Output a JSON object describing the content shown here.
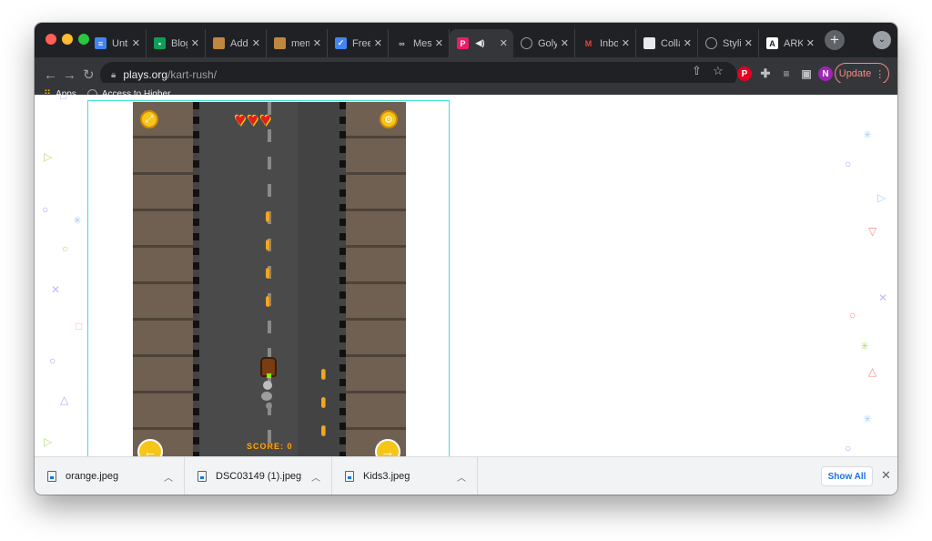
{
  "tabs": [
    {
      "title": "Untitl",
      "favicon": "docs-icon",
      "color": "#4285f4"
    },
    {
      "title": "Blog \\",
      "favicon": "classroom-icon",
      "color": "#0f9d58"
    },
    {
      "title": "Add N",
      "favicon": "img-icon",
      "color": "#e8eaed"
    },
    {
      "title": "meme",
      "favicon": "img-icon",
      "color": "#e8eaed"
    },
    {
      "title": "Free I",
      "favicon": "checkmark-icon",
      "color": "#4285f4"
    },
    {
      "title": "Messa",
      "favicon": "link-icon",
      "color": "#e8eaed"
    },
    {
      "title": "",
      "favicon": "plays-icon",
      "color": "#e91e63",
      "active": true
    },
    {
      "title": "Golya",
      "favicon": "globe-icon",
      "color": "#9aa0a6"
    },
    {
      "title": "Inbox",
      "favicon": "gmail-icon",
      "color": "#ea4335"
    },
    {
      "title": "Collal",
      "favicon": "collab-icon",
      "color": "#e8eaed"
    },
    {
      "title": "Stylin",
      "favicon": "globe-icon",
      "color": "#9aa0a6"
    },
    {
      "title": "ARKE",
      "favicon": "a-icon",
      "color": "#ffffff"
    }
  ],
  "address": {
    "host": "plays.org",
    "path": "/kart-rush/"
  },
  "profile_initial": "N",
  "update_label": "Update",
  "bookmarks": [
    {
      "label": "Apps",
      "icon": "apps-grid-icon"
    },
    {
      "label": "Access to Higher...",
      "icon": "globe-icon"
    }
  ],
  "game": {
    "hearts": 3,
    "score_label": "SCORE: 0"
  },
  "downloads": [
    {
      "name": "orange.jpeg"
    },
    {
      "name": "DSC03149 (1).jpeg"
    },
    {
      "name": "Kids3.jpeg"
    }
  ],
  "show_all_label": "Show All",
  "colors": {
    "accent": "#1a73e8",
    "frame": "#40e0d0",
    "coin": "#f6a61c"
  }
}
